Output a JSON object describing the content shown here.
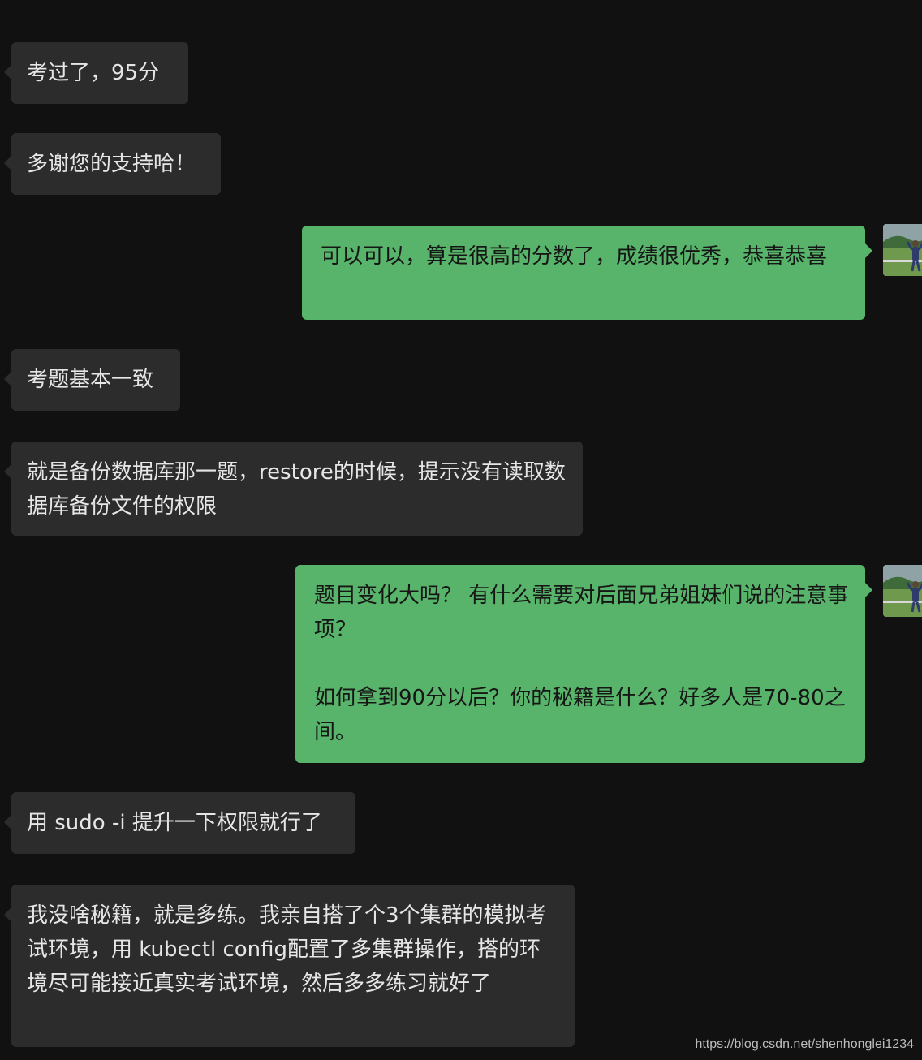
{
  "conversation": {
    "messages": [
      {
        "side": "incoming",
        "text": "考过了，95分"
      },
      {
        "side": "incoming",
        "text": "多谢您的支持哈！"
      },
      {
        "side": "outgoing",
        "text": "可以可以，算是很高的分数了，成绩很优秀，恭喜恭喜"
      },
      {
        "side": "incoming",
        "text": "考题基本一致"
      },
      {
        "side": "incoming",
        "text": "就是备份数据库那一题，restore的时候，提示没有读取数据库备份文件的权限"
      },
      {
        "side": "outgoing",
        "text": "题目变化大吗？ 有什么需要对后面兄弟姐妹们说的注意事项？\n\n如何拿到90分以后？你的秘籍是什么？好多人是70-80之间。"
      },
      {
        "side": "incoming",
        "text": "用 sudo -i 提升一下权限就行了"
      },
      {
        "side": "incoming",
        "text": "我没啥秘籍，就是多练。我亲自搭了个3个集群的模拟考试环境，用 kubectl config配置了多集群操作，搭的环境尽可能接近真实考试环境，然后多多练习就好了"
      }
    ]
  },
  "watermark": "https://blog.csdn.net/shenhonglei1234",
  "colors": {
    "background": "#111111",
    "incoming_bubble": "#2c2c2c",
    "outgoing_bubble": "#57b46a"
  },
  "icons": {
    "avatar": "user-avatar-photo"
  }
}
